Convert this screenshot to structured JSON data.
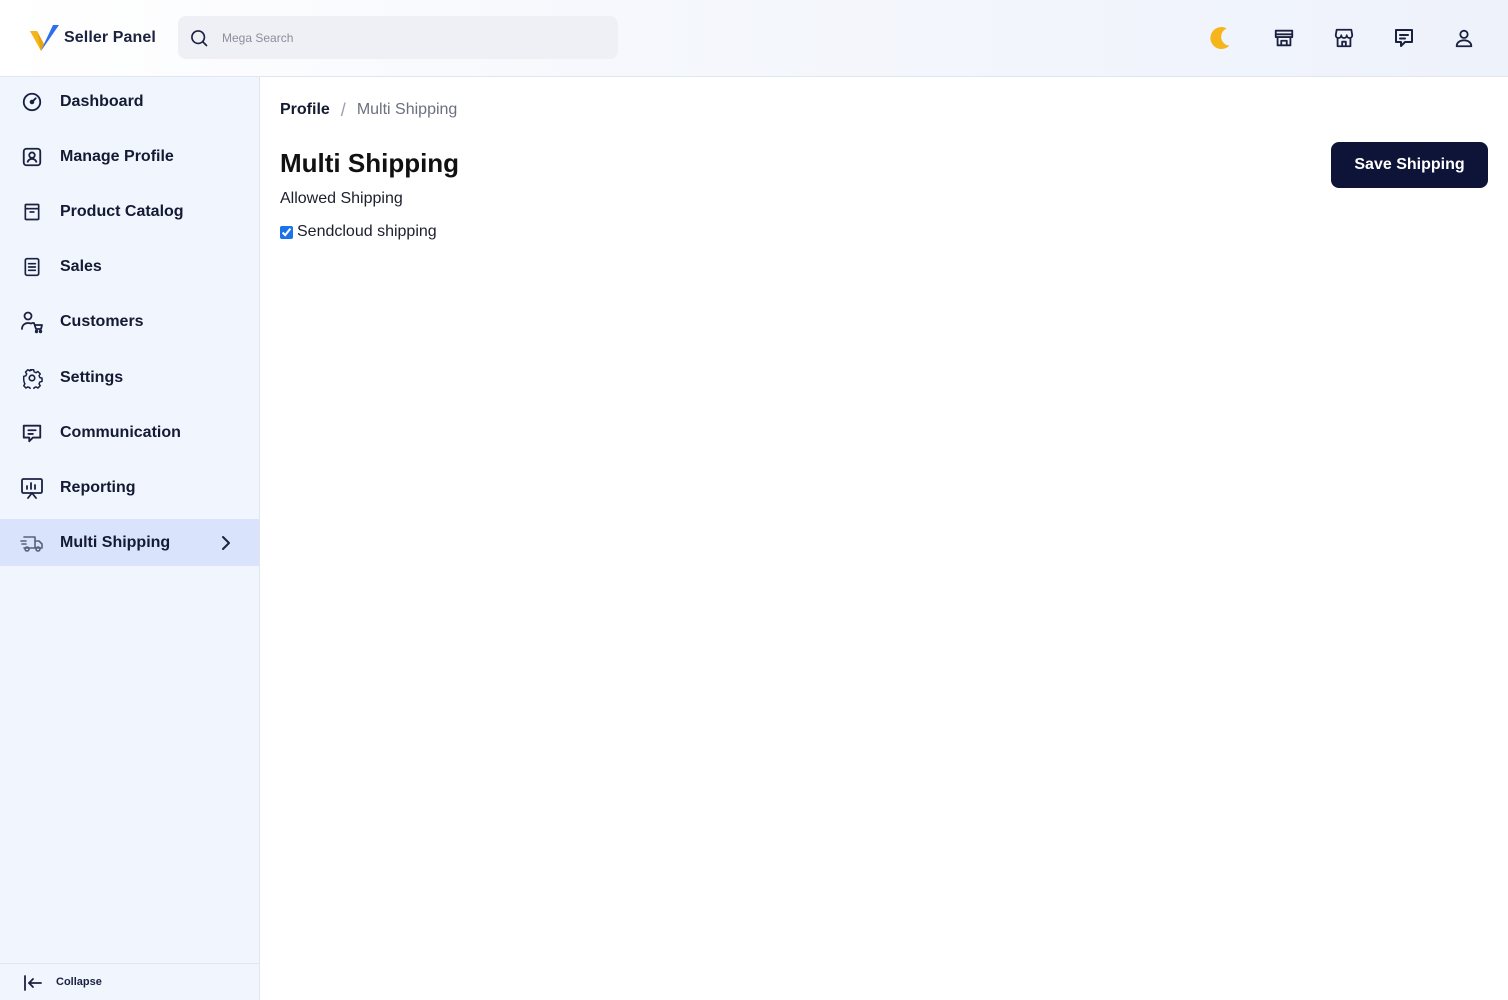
{
  "app": {
    "brand": "Seller Panel",
    "brand_colors": {
      "check_yellow": "#f5b51b",
      "check_blue": "#2f6fed",
      "navy": "#0e1338"
    }
  },
  "header": {
    "search_placeholder": "Mega Search",
    "icons": [
      "moon-icon",
      "storefront-icon",
      "store-icon",
      "chat-icon",
      "user-icon"
    ]
  },
  "sidebar": {
    "items": [
      {
        "label": "Dashboard",
        "icon": "dashboard-icon"
      },
      {
        "label": "Manage Profile",
        "icon": "profile-icon"
      },
      {
        "label": "Product Catalog",
        "icon": "catalog-icon"
      },
      {
        "label": "Sales",
        "icon": "sales-icon"
      },
      {
        "label": "Customers",
        "icon": "customers-icon"
      },
      {
        "label": "Settings",
        "icon": "gear-icon"
      },
      {
        "label": "Communication",
        "icon": "chat-icon"
      },
      {
        "label": "Reporting",
        "icon": "reporting-icon"
      },
      {
        "label": "Multi Shipping",
        "icon": "truck-icon",
        "active": true
      }
    ],
    "collapse_label": "Collapse"
  },
  "breadcrumb": {
    "parent": "Profile",
    "separator": "/",
    "current": "Multi Shipping"
  },
  "main": {
    "title": "Multi Shipping",
    "section_label": "Allowed Shipping",
    "options": [
      {
        "label": "Sendcloud shipping",
        "checked": true
      }
    ],
    "save_button": "Save Shipping"
  }
}
